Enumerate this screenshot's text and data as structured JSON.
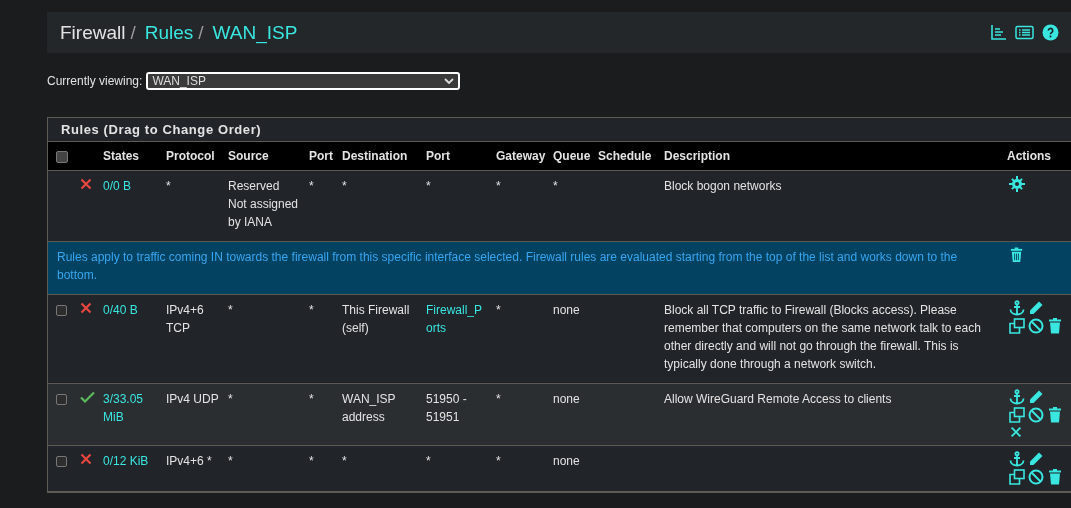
{
  "breadcrumb": [
    {
      "label": "Firewall",
      "link": false,
      "separator": "/"
    },
    {
      "label": "Rules",
      "link": true,
      "separator": "/"
    },
    {
      "label": "WAN_ISP",
      "link": true
    }
  ],
  "viewing": {
    "label": "Currently viewing:",
    "value": "WAN_ISP"
  },
  "panel": {
    "title": "Rules (Drag to Change Order)"
  },
  "table": {
    "select_all_checked": false,
    "columns": [
      "States",
      "Protocol",
      "Source",
      "Port",
      "Destination",
      "Port",
      "Gateway",
      "Queue",
      "Schedule",
      "Description",
      "Actions"
    ],
    "rows": [
      {
        "kind": "default",
        "blocked": true,
        "states": "0/0 B",
        "protocol": "*",
        "source": "Reserved Not assigned by IANA",
        "source_port": "*",
        "destination": "*",
        "dest_port": "*",
        "dest_port_link": false,
        "gateway": "*",
        "queue": "*",
        "description": "Block bogon networks"
      },
      {
        "kind": "info",
        "text": "Rules apply to traffic coming IN towards the firewall from this specific interface selected. Firewall rules are evaluated starting from the top of the list and works down to the bottom."
      },
      {
        "kind": "rule",
        "checked": false,
        "blocked": true,
        "has_states": false,
        "states": "0/40 B",
        "protocol": "IPv4+6 TCP",
        "source": "*",
        "source_port": "*",
        "destination": "This Firewall (self)",
        "dest_port": "Firewall_Ports",
        "dest_port_link": true,
        "gateway": "*",
        "queue": "none",
        "description": "Block all TCP traffic to Firewall (Blocks access). Please remember that computers on the same network talk to each other directly and will not go through the firewall. This is typically done through a network switch."
      },
      {
        "kind": "rule",
        "checked": false,
        "blocked": false,
        "has_states": true,
        "states": "3/33.05 MiB",
        "protocol": "IPv4 UDP",
        "source": "*",
        "source_port": "*",
        "destination": "WAN_ISP address",
        "dest_port": "51950 - 51951",
        "dest_port_link": false,
        "gateway": "*",
        "queue": "none",
        "description": "Allow WireGuard Remote Access to clients"
      },
      {
        "kind": "rule",
        "checked": false,
        "blocked": true,
        "has_states": false,
        "states": "0/12 KiB",
        "protocol": "IPv4+6 *",
        "source": "*",
        "source_port": "*",
        "destination": "*",
        "dest_port": "*",
        "dest_port_link": false,
        "gateway": "*",
        "queue": "none",
        "description": ""
      }
    ]
  }
}
